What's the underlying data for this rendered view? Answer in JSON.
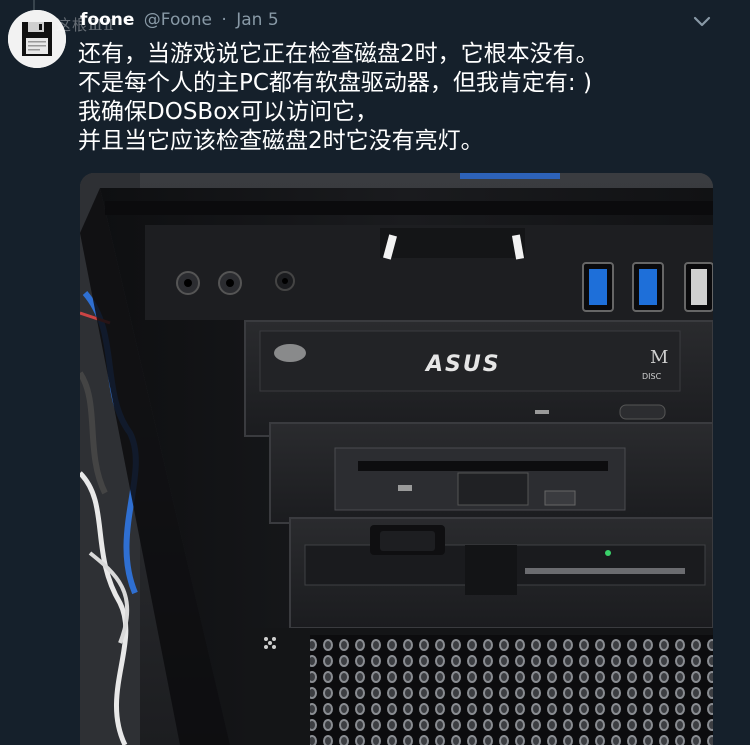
{
  "tweet": {
    "display_name": "foone",
    "handle": "@Foone",
    "separator": "·",
    "date": "Jan 5",
    "watermark": "这根ⅢⅡ",
    "text_lines": [
      "还有，当游戏说它正在检查磁盘2时，它根本没有。",
      " 不是每个人的主PC都有软盘驱动器，但我肯定有: )",
      "我确保DOSBox可以访问它，",
      "并且当它应该检查磁盘2时它没有亮灯。"
    ]
  },
  "icons": {
    "menu": "chevron-down-icon",
    "avatar": "floppy-disk-icon"
  },
  "photo": {
    "optical_drive_brand": "ASUS",
    "disc_label_m": "M",
    "disc_label_disc": "DISC"
  },
  "colors": {
    "background": "#15202b",
    "secondary_text": "#8899a6",
    "usb_blue": "#1e6fd9"
  }
}
